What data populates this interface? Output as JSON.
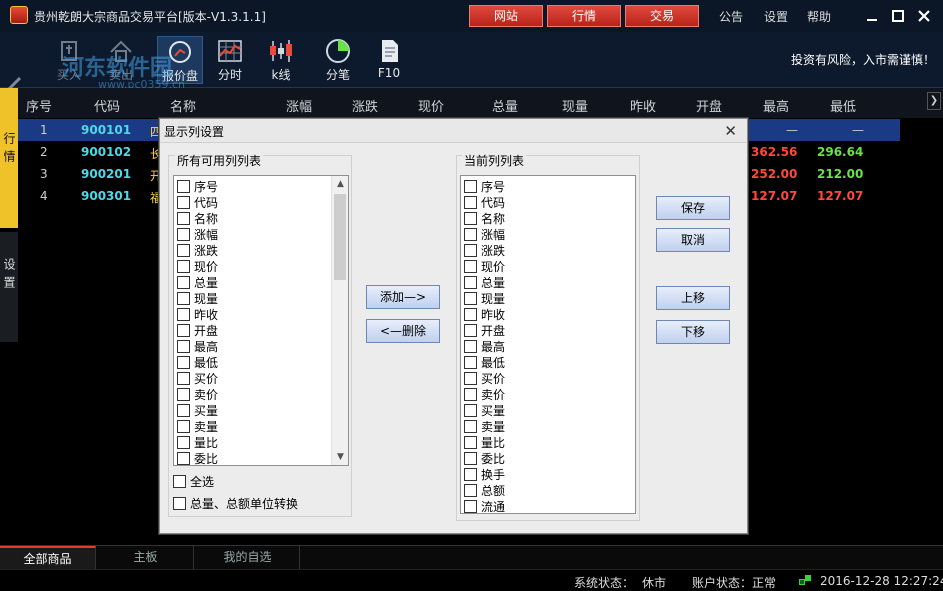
{
  "app": {
    "title": "贵州乾朗大宗商品交易平台[版本-V1.3.1.1]",
    "nav_buttons": [
      "网站",
      "行情",
      "交易"
    ],
    "menus": [
      "公告",
      "设置",
      "帮助"
    ],
    "window_controls": [
      "minimize",
      "maximize",
      "close"
    ]
  },
  "watermark": {
    "text": "河东软件园",
    "url": "www.pc0359.cn"
  },
  "toolbar": {
    "items": [
      {
        "label": "买入",
        "icon": "buy-icon",
        "state": "disabled"
      },
      {
        "label": "卖出",
        "icon": "sell-icon",
        "state": "disabled"
      },
      {
        "label": "报价盘",
        "icon": "quote-board-icon",
        "state": "active"
      },
      {
        "label": "分时",
        "icon": "timeshare-icon",
        "state": "normal"
      },
      {
        "label": "k线",
        "icon": "kline-icon",
        "state": "normal"
      },
      {
        "label": "分笔",
        "icon": "tick-icon",
        "state": "normal"
      },
      {
        "label": "F10",
        "icon": "f10-doc-icon",
        "state": "normal"
      }
    ],
    "risk_notice": "投资有风险，入市需谨慎！"
  },
  "side_tabs": [
    "行情",
    "设置"
  ],
  "table": {
    "headers": [
      "序号",
      "代码",
      "名称",
      "涨幅",
      "涨跌",
      "现价",
      "总量",
      "现量",
      "昨收",
      "开盘",
      "最高",
      "最低"
    ],
    "rows": [
      {
        "idx": "1",
        "code": "900101",
        "name": "四",
        "high": "—",
        "low": "—"
      },
      {
        "idx": "2",
        "code": "900102",
        "name": "长",
        "high": "362.56",
        "low": "296.64"
      },
      {
        "idx": "3",
        "code": "900201",
        "name": "开",
        "high": "252.00",
        "low": "212.00"
      },
      {
        "idx": "4",
        "code": "900301",
        "name": "福",
        "high": "127.07",
        "low": "127.07"
      }
    ],
    "colors": {
      "up": "#ff4a3a",
      "down": "#6be04b",
      "code": "#4fd8e6",
      "selected_row": "#1b3a86"
    }
  },
  "dialog": {
    "title": "显示列设置",
    "available_label": "所有可用列列表",
    "current_label": "当前列列表",
    "available_items": [
      "序号",
      "代码",
      "名称",
      "涨幅",
      "涨跌",
      "现价",
      "总量",
      "现量",
      "昨收",
      "开盘",
      "最高",
      "最低",
      "买价",
      "卖价",
      "买量",
      "卖量",
      "量比",
      "委比"
    ],
    "current_items": [
      "序号",
      "代码",
      "名称",
      "涨幅",
      "涨跌",
      "现价",
      "总量",
      "现量",
      "昨收",
      "开盘",
      "最高",
      "最低",
      "买价",
      "卖价",
      "买量",
      "卖量",
      "量比",
      "委比",
      "换手",
      "总额",
      "流通"
    ],
    "add_button": "添加—>",
    "remove_button": "<—删除",
    "save_button": "保存",
    "cancel_button": "取消",
    "up_button": "上移",
    "down_button": "下移",
    "select_all": "全选",
    "unit_convert": "总量、总额单位转换"
  },
  "bottom_tabs": [
    "全部商品",
    "主板",
    "我的自选"
  ],
  "status": {
    "system_label": "系统状态：",
    "system_value": "休市",
    "account_label": "账户状态：",
    "account_value": "正常",
    "datetime": "2016-12-28 12:27:24"
  }
}
